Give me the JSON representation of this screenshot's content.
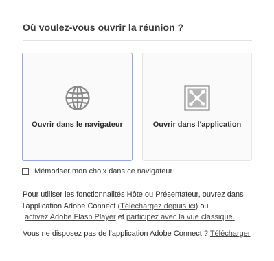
{
  "dialog": {
    "title": "Où voulez-vous ouvrir la réunion ?"
  },
  "options": {
    "browser": {
      "label": "Ouvrir dans le navigateur",
      "icon": "globe-icon",
      "selected": true
    },
    "application": {
      "label": "Ouvrir dans l'application",
      "icon": "adobe-connect-app-icon",
      "selected": false
    }
  },
  "remember": {
    "label": "Mémoriser mon choix dans ce navigateur",
    "checked": false
  },
  "info": {
    "line1": "Pour utiliser les fonctionnalités Hôte ou Présentateur, ouvrez dans",
    "line2_prefix": "l'application Adobe Connect (",
    "line2_link": "Téléchargez depuis ici",
    "line2_suffix": ") ou",
    "line3_link1": "activez Adobe Flash Player",
    "line3_middle": " et ",
    "line3_link2": "participez avec la vue classique."
  },
  "download": {
    "question": "Vous ne disposez pas de l'application Adobe Connect ? ",
    "link": "Télécharger"
  },
  "colors": {
    "selected_border": "#93a9e6",
    "card_background": "#fafafa",
    "icon_gray": "#8a8a8a"
  }
}
